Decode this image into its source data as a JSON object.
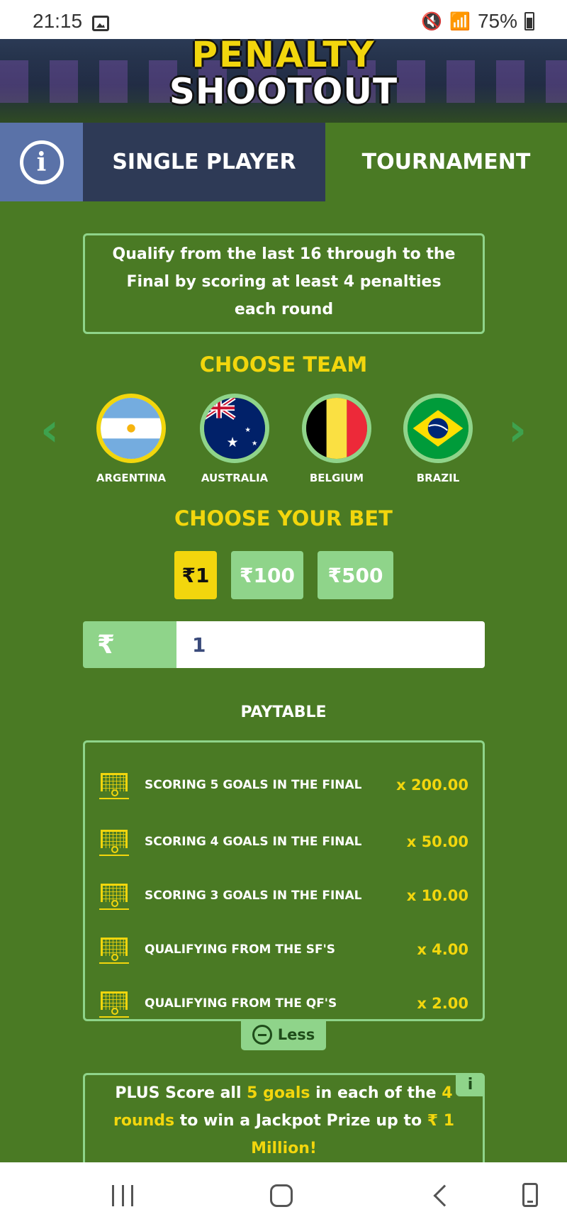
{
  "status_bar": {
    "time": "21:15",
    "battery": "75%"
  },
  "header": {
    "logo_line1": "PENALTY",
    "logo_line2": "SHOOTOUT"
  },
  "tabs": {
    "single_player": "SINGLE PLAYER",
    "tournament": "TOURNAMENT",
    "selected": "TOURNAMENT"
  },
  "description": "Qualify from the last 16 through to the Final by scoring at least 4 penalties each round",
  "choose_team": {
    "title": "CHOOSE TEAM",
    "selected": "ARGENTINA",
    "teams": [
      {
        "name": "ARGENTINA"
      },
      {
        "name": "AUSTRALIA"
      },
      {
        "name": "BELGIUM"
      },
      {
        "name": "BRAZIL"
      }
    ]
  },
  "choose_bet": {
    "title": "CHOOSE YOUR BET",
    "options": [
      "₹1",
      "₹100",
      "₹500"
    ],
    "selected": "₹1",
    "currency_symbol": "₹",
    "input_value": "1"
  },
  "paytable": {
    "title": "PAYTABLE",
    "rows": [
      {
        "label": "SCORING 5 GOALS IN THE FINAL",
        "multiplier": "x 200.00"
      },
      {
        "label": "SCORING 4 GOALS IN THE FINAL",
        "multiplier": "x 50.00"
      },
      {
        "label": "SCORING 3 GOALS IN THE FINAL",
        "multiplier": "x 10.00"
      },
      {
        "label": "QUALIFYING FROM THE SF'S",
        "multiplier": "x 4.00"
      },
      {
        "label": "QUALIFYING FROM THE QF'S",
        "multiplier": "x 2.00"
      }
    ],
    "less_label": "Less"
  },
  "jackpot": {
    "t1": "PLUS Score all ",
    "h1": "5 goals",
    "t2": " in each of the ",
    "h2": "4 rounds",
    "t3": " to win a Jackpot Prize up to ",
    "h3": "₹ 1 Million!",
    "info_label": "i"
  },
  "colors": {
    "background": "#4a7a24",
    "accent_yellow": "#f2d60d",
    "light_green": "#8fd48a",
    "tab_dark": "#2e3a56",
    "info_tab": "#5a72a8"
  }
}
